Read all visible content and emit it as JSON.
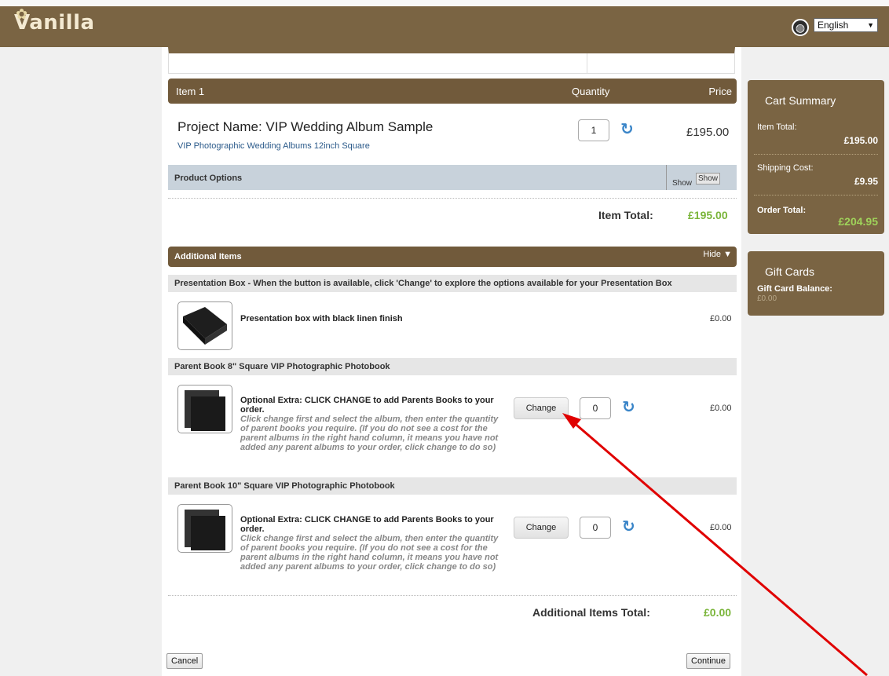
{
  "brand": {
    "logo_text": "Vanilla"
  },
  "language": {
    "selected": "English"
  },
  "cart_item": {
    "header": {
      "item": "Item 1",
      "quantity": "Quantity",
      "price": "Price"
    },
    "project_name": "Project Name: VIP Wedding Album Sample",
    "product": "VIP Photographic Wedding Albums 12inch Square",
    "quantity": "1",
    "price": "£195.00",
    "product_options": {
      "label": "Product Options",
      "show_text": "Show",
      "show_image_alt": "Show"
    },
    "item_total_label": "Item Total:",
    "item_total_value": "£195.00"
  },
  "additional_items": {
    "header": "Additional Items",
    "toggle": "Hide",
    "sections": [
      {
        "title": "Presentation Box - When the button is available, click 'Change' to explore the options available for your Presentation Box",
        "description": "Presentation box with black linen finish",
        "price": "£0.00"
      },
      {
        "title": "Parent Book 8\" Square VIP Photographic Photobook",
        "description": "Optional Extra: CLICK CHANGE to add Parents Books to your order.",
        "note": "Click change first and select the album, then enter the quantity of parent books you require. (If you do not see a cost for the parent albums in the right hand column, it means you have not added any parent albums to your order, click change to do so)",
        "button": "Change",
        "quantity": "0",
        "price": "£0.00"
      },
      {
        "title": "Parent Book 10\" Square VIP Photographic Photobook",
        "description": "Optional Extra: CLICK CHANGE to add Parents Books to your order.",
        "note": "Click change first and select the album, then enter the quantity of parent books you require. (If you do not see a cost for the parent albums in the right hand column, it means you have not added any parent albums to your order, click change to do so)",
        "button": "Change",
        "quantity": "0",
        "price": "£0.00"
      }
    ],
    "total_label": "Additional Items Total:",
    "total_value": "£0.00"
  },
  "buttons": {
    "cancel": "Cancel",
    "continue": "Continue"
  },
  "cart_summary": {
    "title": "Cart Summary",
    "item_total_label": "Item Total:",
    "item_total_value": "£195.00",
    "shipping_label": "Shipping Cost:",
    "shipping_value": "£9.95",
    "order_total_label": "Order Total:",
    "order_total_value": "£204.95"
  },
  "gift_cards": {
    "title": "Gift Cards",
    "balance_label": "Gift Card Balance:",
    "balance_value": "£0.00"
  },
  "colors": {
    "brand_brown": "#7a6443",
    "total_green": "#7ab53a",
    "annotation_red": "#e00000"
  }
}
